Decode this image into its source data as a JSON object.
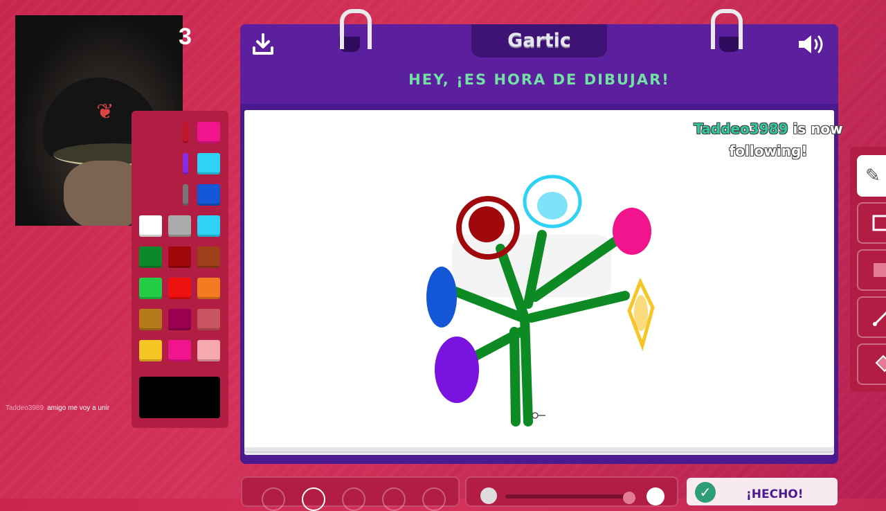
{
  "round": {
    "number": "3"
  },
  "game": {
    "logo": "Gartic",
    "instruction": "HEY, ¡ES HORA DE DIBUJAR!",
    "done_label": "¡HECHO!"
  },
  "notification": {
    "user": "Taddeo3989",
    "text_line1": "is now",
    "text_line2": "following!"
  },
  "chat": {
    "user": "Taddeo3989",
    "message": "amigo me voy a unir"
  },
  "palette": {
    "colors": [
      [
        "#c0162a",
        "#f2148c"
      ],
      [
        "#8a2be2",
        "#2ed2f5"
      ],
      [
        "#777777",
        "#1457d6"
      ],
      [
        "#ffffff",
        "#aaaaaa",
        "#2ed2f5"
      ],
      [
        "#0a8a2a",
        "#a0080c",
        "#a0401a"
      ],
      [
        "#22cc44",
        "#ef1010",
        "#f57b22"
      ],
      [
        "#b67a1c",
        "#990050",
        "#c95560"
      ],
      [
        "#f8c526",
        "#f2148c",
        "#f7a8ae"
      ]
    ],
    "selected": "#000000"
  },
  "icons": {
    "download": "download-icon",
    "sound": "speaker-icon",
    "tools": [
      "pencil-icon",
      "rectangle-outline-icon",
      "rectangle-fill-icon",
      "line-icon",
      "fill-bucket-icon"
    ]
  }
}
